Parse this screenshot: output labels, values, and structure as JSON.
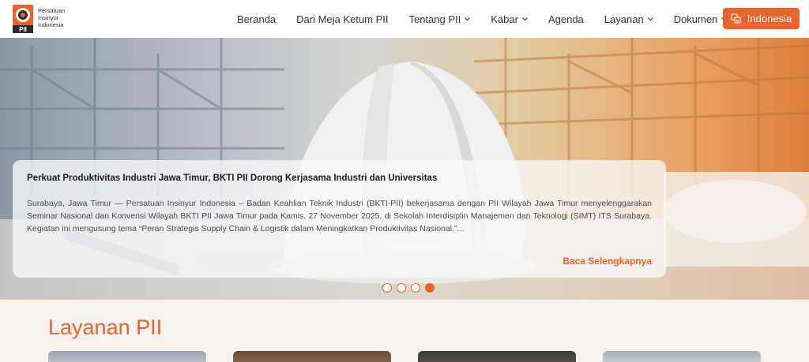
{
  "header": {
    "logo_text": [
      "Persatuan",
      "Insinyur",
      "Indonesia"
    ],
    "logo_badge": "PII",
    "nav": [
      {
        "label": "Beranda",
        "dropdown": false
      },
      {
        "label": "Dari Meja Ketum PII",
        "dropdown": false
      },
      {
        "label": "Tentang PII",
        "dropdown": true
      },
      {
        "label": "Kabar",
        "dropdown": true
      },
      {
        "label": "Agenda",
        "dropdown": false
      },
      {
        "label": "Layanan",
        "dropdown": true
      },
      {
        "label": "Dokumen",
        "dropdown": true
      }
    ],
    "language_button": "Indonesia"
  },
  "hero": {
    "title": "Perkuat Produktivitas Industri Jawa Timur, BKTI PII Dorong Kerjasama Industri dan Universitas",
    "body": "Surabaya, Jawa Timur — Persatuan Insinyur Indonesia – Badan Keahlian Teknik Industri (BKTI-PII) bekerjasama dengan PII Wilayah Jawa Timur menyelenggarakan Seminar Nasional dan Konvensi Wilayah BKTI PII Jawa Timur pada Kamis, 27 November 2025, di Sekolah Interdisiplin Manajemen dan Teknologi (SIMT) ITS Surabaya. Kegiatan ini mengusung tema “Peran Strategis Supply Chain & Logistik dalam Meningkatkan Produktivitas Nasional.”...",
    "read_more": "Baca Selengkapnya",
    "slides_count": 4,
    "active_slide": 4
  },
  "services": {
    "title": "Layanan PII",
    "card_count": 4
  },
  "colors": {
    "accent": "#e8642c",
    "nav_text": "#333333",
    "background": "#f7f2ee"
  },
  "icons": {
    "chevron": "chevron-down-icon",
    "language": "translate-icon"
  }
}
